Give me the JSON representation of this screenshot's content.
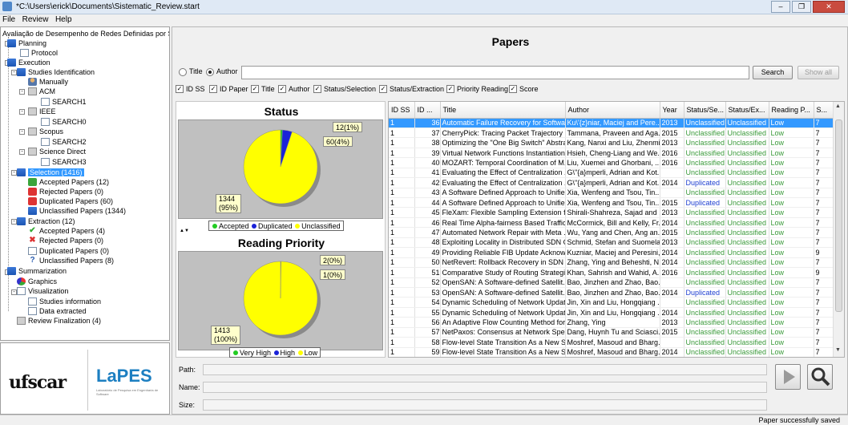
{
  "window": {
    "title": "*C:\\Users\\erick\\Documents\\Sistematic_Review.start"
  },
  "menu": [
    "File",
    "Review",
    "Help"
  ],
  "tree": {
    "root": "Avaliação de Desempenho de Redes Definidas por Soft",
    "planning": "Planning",
    "protocol": "Protocol",
    "execution": "Execution",
    "studies_identification": "Studies Identification",
    "manually": "Manually",
    "acm": "ACM",
    "acm_search": "SEARCH1",
    "ieee": "IEEE",
    "ieee_search": "SEARCH0",
    "scopus": "Scopus",
    "scopus_search": "SEARCH2",
    "science_direct": "Science Direct",
    "science_direct_search": "SEARCH3",
    "selection": "Selection (1416)",
    "sel_accepted": "Accepted Papers (12)",
    "sel_rejected": "Rejected Papers (0)",
    "sel_duplicated": "Duplicated Papers (60)",
    "sel_unclassified": "Unclassified Papers (1344)",
    "extraction": "Extraction (12)",
    "ext_accepted": "Accepted Papers (4)",
    "ext_rejected": "Rejected Papers (0)",
    "ext_duplicated": "Duplicated Papers (0)",
    "ext_unclassified": "Unclassified Papers (8)",
    "summarization": "Summarization",
    "graphics": "Graphics",
    "visualization": "Visualization",
    "studies_information": "Studies information",
    "data_extracted": "Data extracted",
    "review_finalization": "Review Finalization (4)"
  },
  "logos": {
    "left": "ufscar",
    "right": "LaPES",
    "right_sub": "Laboratório de Pesquisa em Engenharia de Software"
  },
  "main": {
    "title": "Papers",
    "search": {
      "radio_title": "Title",
      "radio_author": "Author",
      "selected": "Author",
      "value": "",
      "search_btn": "Search",
      "show_all_btn": "Show all"
    },
    "column_toggles": [
      "ID SS",
      "ID Paper",
      "Title",
      "Author",
      "Status/Selection",
      "Status/Extraction",
      "Priority Reading",
      "Score"
    ],
    "charts": [
      {
        "title": "Status",
        "labels": [
          "12(1%)",
          "60(4%)",
          "1344\n(95%)"
        ],
        "legend": [
          {
            "name": "Accepted",
            "color": "#22cc22"
          },
          {
            "name": "Duplicated",
            "color": "#1a22d8"
          },
          {
            "name": "Unclassified",
            "color": "#ffff00"
          }
        ]
      },
      {
        "title": "Reading Priority",
        "labels": [
          "2(0%)",
          "1(0%)",
          "1413\n(100%)"
        ],
        "legend": [
          {
            "name": "Very High",
            "color": "#22cc22"
          },
          {
            "name": "High",
            "color": "#1a22d8"
          },
          {
            "name": "Low",
            "color": "#ffff00"
          }
        ]
      }
    ],
    "chart_data": [
      {
        "type": "pie",
        "title": "Status",
        "categories": [
          "Accepted",
          "Duplicated",
          "Unclassified"
        ],
        "values": [
          12,
          60,
          1344
        ],
        "percent": [
          1,
          4,
          95
        ],
        "colors": [
          "#22cc22",
          "#1a22d8",
          "#ffff00"
        ]
      },
      {
        "type": "pie",
        "title": "Reading Priority",
        "categories": [
          "Very High",
          "High",
          "Low"
        ],
        "values": [
          2,
          1,
          1413
        ],
        "percent": [
          0,
          0,
          100
        ],
        "colors": [
          "#22cc22",
          "#1a22d8",
          "#ffff00"
        ]
      }
    ],
    "table": {
      "columns": [
        "ID SS",
        "ID ...",
        "Title",
        "Author",
        "Year",
        "Status/Se...",
        "Status/Ex...",
        "Reading P...",
        "S..."
      ],
      "rows": [
        [
          "1",
          "36",
          "Automatic Failure Recovery for Softwa...",
          "Ku\\'{z}niar, Maciej and Pere...",
          "2013",
          "Unclassified",
          "Unclassified",
          "Low",
          "7"
        ],
        [
          "1",
          "37",
          "CherryPick: Tracing Packet Trajectory i...",
          "Tammana, Praveen and Aga...",
          "2015",
          "Unclassified",
          "Unclassified",
          "Low",
          "7"
        ],
        [
          "1",
          "38",
          "Optimizing the \"One Big Switch\" Abstra...",
          "Kang, Nanxi and Liu, Zhenmi...",
          "2013",
          "Unclassified",
          "Unclassified",
          "Low",
          "7"
        ],
        [
          "1",
          "39",
          "Virtual Network Functions Instantiation...",
          "Hsieh, Cheng-Liang and We...",
          "2016",
          "Unclassified",
          "Unclassified",
          "Low",
          "7"
        ],
        [
          "1",
          "40",
          "MOZART: Temporal Coordination of M...",
          "Liu, Xuemei and Ghorbani, ...",
          "2016",
          "Unclassified",
          "Unclassified",
          "Low",
          "7"
        ],
        [
          "1",
          "41",
          "Evaluating the Effect of Centralization ...",
          "G\\\"{a}mperli, Adrian and Kot...",
          "",
          "Unclassified",
          "Unclassified",
          "Low",
          "7"
        ],
        [
          "1",
          "42",
          "Evaluating the Effect of Centralization ...",
          "G\\\"{a}mperli, Adrian and Kot...",
          "2014",
          "Duplicated",
          "Unclassified",
          "Low",
          "7"
        ],
        [
          "1",
          "43",
          "A Software Defined Approach to Unifie...",
          "Xia, Wenfeng and Tsou, Tin...",
          "",
          "Unclassified",
          "Unclassified",
          "Low",
          "7"
        ],
        [
          "1",
          "44",
          "A Software Defined Approach to Unifie...",
          "Xia, Wenfeng and Tsou, Tin...",
          "2015",
          "Duplicated",
          "Unclassified",
          "Low",
          "7"
        ],
        [
          "1",
          "45",
          "FleXam: Flexible Sampling Extension fo...",
          "Shirali-Shahreza, Sajad and ...",
          "2013",
          "Unclassified",
          "Unclassified",
          "Low",
          "7"
        ],
        [
          "1",
          "46",
          "Real Time Alpha-fairness Based Traffic...",
          "McCormick, Bill and Kelly, Fr...",
          "2014",
          "Unclassified",
          "Unclassified",
          "Low",
          "7"
        ],
        [
          "1",
          "47",
          "Automated Network Repair with Meta ...",
          "Wu, Yang and Chen, Ang an...",
          "2015",
          "Unclassified",
          "Unclassified",
          "Low",
          "7"
        ],
        [
          "1",
          "48",
          "Exploiting Locality in Distributed SDN C...",
          "Schmid, Stefan and Suomela...",
          "2013",
          "Unclassified",
          "Unclassified",
          "Low",
          "7"
        ],
        [
          "1",
          "49",
          "Providing Reliable FIB Update Acknowl...",
          "Kuzniar, Maciej and Peresini,...",
          "2014",
          "Unclassified",
          "Unclassified",
          "Low",
          "9"
        ],
        [
          "1",
          "50",
          "NetRevert: Rollback Recovery in SDN",
          "Zhang, Ying and Beheshti, N...",
          "2014",
          "Unclassified",
          "Unclassified",
          "Low",
          "7"
        ],
        [
          "1",
          "51",
          "Comparative Study of Routing Strategi...",
          "Khan, Sahrish and Wahid, A...",
          "2016",
          "Unclassified",
          "Unclassified",
          "Low",
          "9"
        ],
        [
          "1",
          "52",
          "OpenSAN: A Software-defined Satellit...",
          "Bao, Jinzhen and Zhao, Bao...",
          "",
          "Unclassified",
          "Unclassified",
          "Low",
          "7"
        ],
        [
          "1",
          "53",
          "OpenSAN: A Software-defined Satellit...",
          "Bao, Jinzhen and Zhao, Bao...",
          "2014",
          "Duplicated",
          "Unclassified",
          "Low",
          "7"
        ],
        [
          "1",
          "54",
          "Dynamic Scheduling of Network Updates",
          "Jin, Xin and Liu, Hongqiang ...",
          "",
          "Unclassified",
          "Unclassified",
          "Low",
          "7"
        ],
        [
          "1",
          "55",
          "Dynamic Scheduling of Network Updates",
          "Jin, Xin and Liu, Hongqiang ...",
          "2014",
          "Unclassified",
          "Unclassified",
          "Low",
          "7"
        ],
        [
          "1",
          "56",
          "An Adaptive Flow Counting Method for...",
          "Zhang, Ying",
          "2013",
          "Unclassified",
          "Unclassified",
          "Low",
          "7"
        ],
        [
          "1",
          "57",
          "NetPaxos: Consensus at Network Speed",
          "Dang, Huynh Tu and Sciasci...",
          "2015",
          "Unclassified",
          "Unclassified",
          "Low",
          "7"
        ],
        [
          "1",
          "58",
          "Flow-level State Transition As a New S...",
          "Moshref, Masoud and Bharg...",
          "",
          "Unclassified",
          "Unclassified",
          "Low",
          "7"
        ],
        [
          "1",
          "59",
          "Flow-level State Transition As a New S...",
          "Moshref, Masoud and Bharg...",
          "2014",
          "Unclassified",
          "Unclassified",
          "Low",
          "7"
        ]
      ],
      "selected_row": 0
    },
    "details": {
      "path_label": "Path:",
      "name_label": "Name:",
      "size_label": "Size:"
    }
  },
  "status": {
    "message": "Paper successfully saved"
  }
}
